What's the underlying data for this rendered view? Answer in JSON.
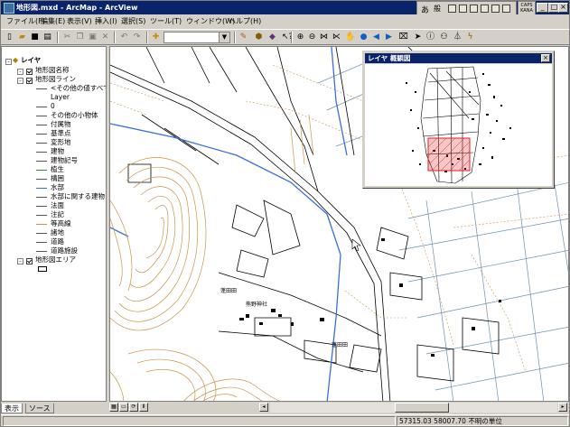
{
  "window": {
    "title": "地形図.mxd - ArcMap - ArcView",
    "min_glyph": "_",
    "max_glyph": "□",
    "close_glyph": "×"
  },
  "ime": {
    "mode_char": "あ",
    "kanji_char": "般",
    "caps_label": "CAPS",
    "kana_label": "KANA"
  },
  "menu": [
    "ファイル(F)",
    "編集(E)",
    "表示(V)",
    "挿入(I)",
    "選択(S)",
    "ツール(T)",
    "ウィンドウ(W)",
    "ヘルプ(H)"
  ],
  "toolbar": {
    "scale_value": ""
  },
  "toc": {
    "root_label": "レイヤ",
    "layer1": "地形図名称",
    "layer2": "地形図ライン",
    "layer2_items": [
      "<その他の値すべて>",
      "Layer",
      "0",
      "その他の小物体",
      "付属物",
      "基準点",
      "変形地",
      "建物",
      "建物記号",
      "植生",
      "構囲",
      "水部",
      "水部に関する建物",
      "法面",
      "注記",
      "等高線",
      "諸地",
      "道路",
      "道路施設"
    ],
    "layer3": "地形図エリア"
  },
  "tabs": {
    "display": "表示",
    "source": "ソース"
  },
  "overview": {
    "title": "レイヤ 概観図"
  },
  "map_labels": {
    "label_a": "蓬田田",
    "label_b": "蓬田田",
    "label_c": "熊野神社"
  },
  "statusbar": {
    "coordinates": "57315.03  58007.70 不明の単位"
  },
  "colors": {
    "title_bar": "#0a246a",
    "chrome": "#d4d0c8",
    "contour": "#c8944a",
    "water": "#3a6fd8",
    "extent_box": "#e02020"
  }
}
